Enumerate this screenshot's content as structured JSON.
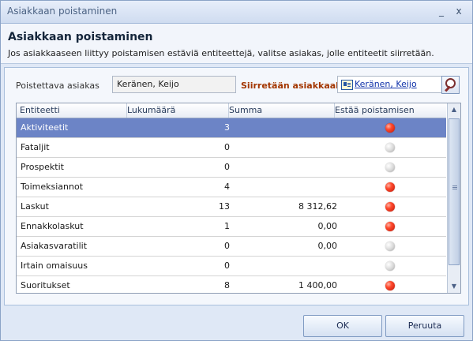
{
  "window": {
    "title": "Asiakkaan poistaminen",
    "controls": [
      "_",
      "x"
    ]
  },
  "header": {
    "title": "Asiakkaan poistaminen",
    "description": "Jos asiakkaaseen liittyy poistamisen estäviä entiteettejä, valitse asiakas, jolle entiteetit siirretään."
  },
  "form": {
    "delete_label": "Poistettava asiakas",
    "delete_value": "Keränen, Keijo",
    "move_label": "Siirretään asiakkaalle",
    "move_value": "Keränen, Keijo"
  },
  "table": {
    "columns": [
      "Entiteetti",
      "Lukumäärä",
      "Summa",
      "Estää poistamisen"
    ],
    "rows": [
      {
        "entity": "Aktiviteetit",
        "count": "3",
        "sum": "",
        "blocks": true,
        "selected": true
      },
      {
        "entity": "Fataljit",
        "count": "0",
        "sum": "",
        "blocks": false
      },
      {
        "entity": "Prospektit",
        "count": "0",
        "sum": "",
        "blocks": false
      },
      {
        "entity": "Toimeksiannot",
        "count": "4",
        "sum": "",
        "blocks": true
      },
      {
        "entity": "Laskut",
        "count": "13",
        "sum": "8 312,62",
        "blocks": true
      },
      {
        "entity": "Ennakkolaskut",
        "count": "1",
        "sum": "0,00",
        "blocks": true
      },
      {
        "entity": "Asiakasvaratilit",
        "count": "0",
        "sum": "0,00",
        "blocks": false
      },
      {
        "entity": "Irtain omaisuus",
        "count": "0",
        "sum": "",
        "blocks": false
      },
      {
        "entity": "Suoritukset",
        "count": "8",
        "sum": "1 400,00",
        "blocks": true
      }
    ]
  },
  "buttons": {
    "ok": "OK",
    "cancel": "Peruuta"
  }
}
